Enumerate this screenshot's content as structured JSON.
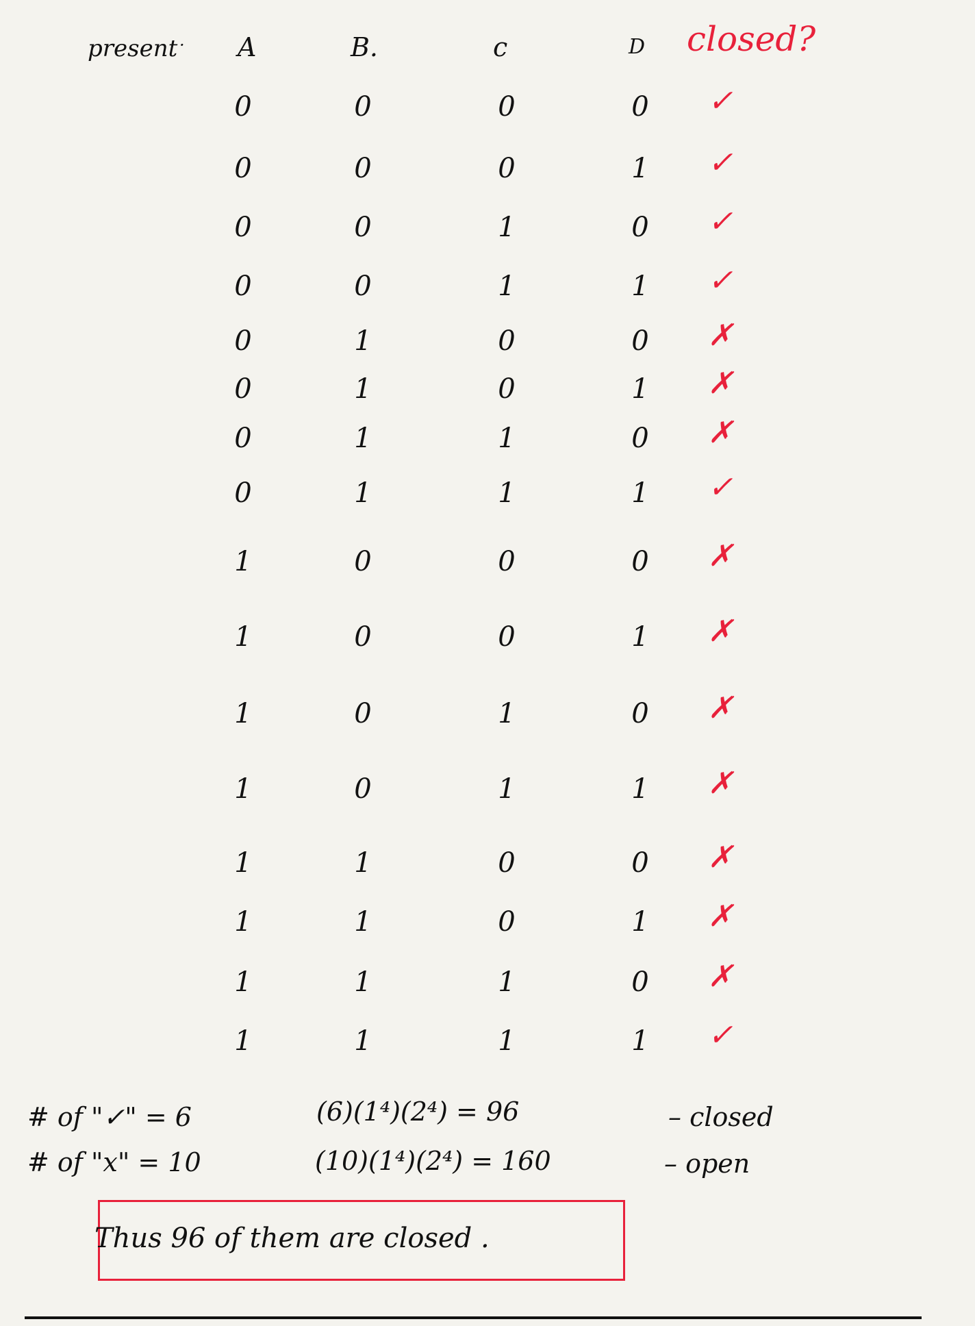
{
  "header": {
    "present": "present",
    "dot": "·",
    "A": "A",
    "B": "B.",
    "C": "c",
    "D": "D",
    "closed": "closed?"
  },
  "rows": [
    {
      "A": "0",
      "B": "0",
      "C": "0",
      "D": "0",
      "mark": "✓"
    },
    {
      "A": "0",
      "B": "0",
      "C": "0",
      "D": "1",
      "mark": "✓"
    },
    {
      "A": "0",
      "B": "0",
      "C": "1",
      "D": "0",
      "mark": "✓"
    },
    {
      "A": "0",
      "B": "0",
      "C": "1",
      "D": "1",
      "mark": "✓"
    },
    {
      "A": "0",
      "B": "1",
      "C": "0",
      "D": "0",
      "mark": "✗"
    },
    {
      "A": "0",
      "B": "1",
      "C": "0",
      "D": "1",
      "mark": "✗"
    },
    {
      "A": "0",
      "B": "1",
      "C": "1",
      "D": "0",
      "mark": "✗"
    },
    {
      "A": "0",
      "B": "1",
      "C": "1",
      "D": "1",
      "mark": "✓"
    },
    {
      "A": "1",
      "B": "0",
      "C": "0",
      "D": "0",
      "mark": "✗"
    },
    {
      "A": "1",
      "B": "0",
      "C": "0",
      "D": "1",
      "mark": "✗"
    },
    {
      "A": "1",
      "B": "0",
      "C": "1",
      "D": "0",
      "mark": "✗"
    },
    {
      "A": "1",
      "B": "0",
      "C": "1",
      "D": "1",
      "mark": "✗"
    },
    {
      "A": "1",
      "B": "1",
      "C": "0",
      "D": "0",
      "mark": "✗"
    },
    {
      "A": "1",
      "B": "1",
      "C": "0",
      "D": "1",
      "mark": "✗"
    },
    {
      "A": "1",
      "B": "1",
      "C": "1",
      "D": "0",
      "mark": "✗"
    },
    {
      "A": "1",
      "B": "1",
      "C": "1",
      "D": "1",
      "mark": "✓"
    }
  ],
  "summary": {
    "check_line": "# of \"✓\"  =  6",
    "x_line": "# of \"x\"  =  10",
    "check_calc": "(6)(1⁴)(2⁴)  =  96",
    "x_calc": "(10)(1⁴)(2⁴)  =  160",
    "check_label": "–   closed",
    "x_label": "–   open"
  },
  "conclusion": "Thus  96   of   them   are   closed ."
}
